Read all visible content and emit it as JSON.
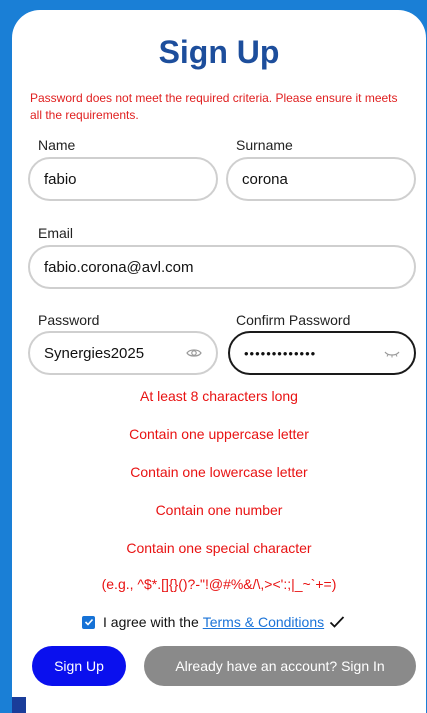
{
  "form": {
    "title": "Sign Up",
    "error_message": "Password does not meet the required criteria. Please ensure it meets all the requirements.",
    "fields": {
      "name": {
        "label": "Name",
        "value": "fabio"
      },
      "surname": {
        "label": "Surname",
        "value": "corona"
      },
      "email": {
        "label": "Email",
        "value": "fabio.corona@avl.com"
      },
      "password": {
        "label": "Password",
        "value": "Synergies2025"
      },
      "confirm_password": {
        "label": "Confirm Password",
        "value": "•••••••••••••"
      }
    },
    "requirements": [
      "At least 8 characters long",
      "Contain one uppercase letter",
      "Contain one lowercase letter",
      "Contain one number",
      "Contain one special character",
      "(e.g., ^$*.[]{}()?-\"!@#%&/\\,><':;|_~`+=)"
    ],
    "agree": {
      "checked": true,
      "text": "I agree with the",
      "link": "Terms & Conditions"
    },
    "buttons": {
      "signup": "Sign Up",
      "signin": "Already have an account? Sign In"
    }
  },
  "colors": {
    "background": "#1a7fd6",
    "title": "#1d4e9c",
    "error": "#e02020",
    "primary_button": "#0a10ee",
    "secondary_button": "#8a8a8a",
    "link": "#1a73d8"
  },
  "icons": {
    "password_toggle": "eye-icon",
    "confirm_password_toggle": "eye-closed-icon",
    "checkmark": "checkmark-icon"
  }
}
